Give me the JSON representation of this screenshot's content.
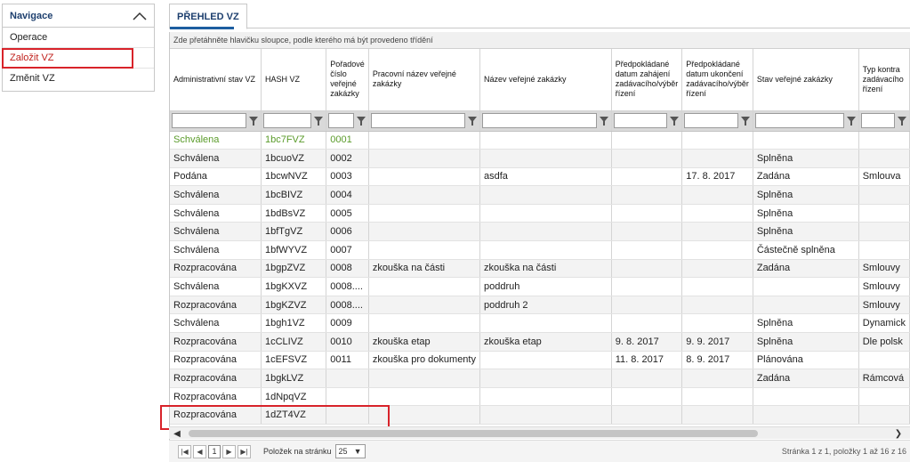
{
  "sidebar": {
    "title": "Navigace",
    "items": [
      {
        "label": "Operace"
      },
      {
        "label": "Založit VZ"
      },
      {
        "label": "Změnit VZ"
      }
    ]
  },
  "tab": {
    "label": "PŘEHLED VZ"
  },
  "grid": {
    "group_hint": "Zde přetáhněte hlavičku sloupce, podle kterého má být provedeno třídění",
    "columns": [
      "Administrativní stav VZ",
      "HASH VZ",
      "Pořadové číslo veřejné zakázky",
      "Pracovní název veřejné zakázky",
      "Název veřejné zakázky",
      "Předpokládané datum zahájení zadávacího/výběr řízení",
      "Předpokládané datum ukončení zadávacího/výběr řízení",
      "Stav veřejné zakázky",
      "Typ kontra zadávacího řízení"
    ],
    "rows": [
      [
        "Schválena",
        "1bc7FVZ",
        "0001",
        "",
        "",
        "",
        "",
        "",
        ""
      ],
      [
        "Schválena",
        "1bcuoVZ",
        "0002",
        "",
        "",
        "",
        "",
        "Splněna",
        ""
      ],
      [
        "Podána",
        "1bcwNVZ",
        "0003",
        "",
        "asdfa",
        "",
        "17. 8. 2017",
        "Zadána",
        "Smlouva"
      ],
      [
        "Schválena",
        "1bcBIVZ",
        "0004",
        "",
        "",
        "",
        "",
        "Splněna",
        ""
      ],
      [
        "Schválena",
        "1bdBsVZ",
        "0005",
        "",
        "",
        "",
        "",
        "Splněna",
        ""
      ],
      [
        "Schválena",
        "1bfTgVZ",
        "0006",
        "",
        "",
        "",
        "",
        "Splněna",
        ""
      ],
      [
        "Schválena",
        "1bfWYVZ",
        "0007",
        "",
        "",
        "",
        "",
        "Částečně splněna",
        ""
      ],
      [
        "Rozpracována",
        "1bgpZVZ",
        "0008",
        "zkouška na části",
        "zkouška na části",
        "",
        "",
        "Zadána",
        "Smlouvy"
      ],
      [
        "Schválena",
        "1bgKXVZ",
        "0008....",
        "",
        "poddruh",
        "",
        "",
        "",
        "Smlouvy"
      ],
      [
        "Rozpracována",
        "1bgKZVZ",
        "0008....",
        "",
        "poddruh 2",
        "",
        "",
        "",
        "Smlouvy"
      ],
      [
        "Schválena",
        "1bgh1VZ",
        "0009",
        "",
        "",
        "",
        "",
        "Splněna",
        "Dynamick"
      ],
      [
        "Rozpracována",
        "1cCLIVZ",
        "0010",
        "zkouška etap",
        "zkouška etap",
        "9. 8. 2017",
        "9. 9. 2017",
        "Splněna",
        "Dle polsk"
      ],
      [
        "Rozpracována",
        "1cEFSVZ",
        "0011",
        "zkouška pro dokumenty",
        "",
        "11. 8. 2017",
        "8. 9. 2017",
        "Plánována",
        ""
      ],
      [
        "Rozpracována",
        "1bgkLVZ",
        "",
        "",
        "",
        "",
        "",
        "Zadána",
        "Rámcová"
      ],
      [
        "Rozpracována",
        "1dNpqVZ",
        "",
        "",
        "",
        "",
        "",
        "",
        ""
      ],
      [
        "Rozpracována",
        "1dZT4VZ",
        "",
        "",
        "",
        "",
        "",
        "",
        ""
      ]
    ]
  },
  "pager": {
    "current_page": "1",
    "page_size_label": "Položek na stránku",
    "page_size": "25",
    "info": "Stránka 1 z 1, položky 1 až 16 z 16"
  },
  "colors": {
    "brand": "#1d3f6e",
    "highlight": "#d8232a",
    "approved_green": "#5a9b2a"
  }
}
